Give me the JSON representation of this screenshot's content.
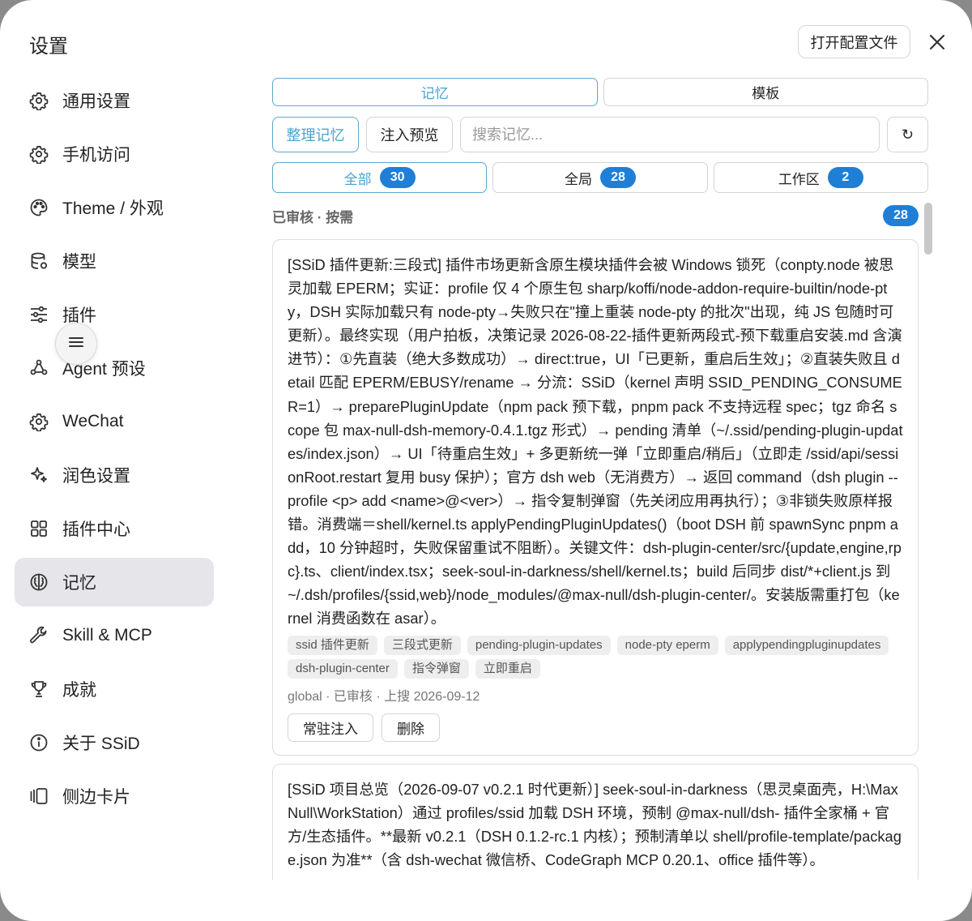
{
  "window": {
    "title": "设置",
    "open_config_label": "打开配置文件"
  },
  "sidebar": {
    "items": [
      {
        "label": "通用设置",
        "icon": "gear-icon"
      },
      {
        "label": "手机访问",
        "icon": "gear-icon"
      },
      {
        "label": "Theme / 外观",
        "icon": "palette-icon"
      },
      {
        "label": "模型",
        "icon": "database-icon"
      },
      {
        "label": "插件",
        "icon": "sliders-icon"
      },
      {
        "label": "Agent 预设",
        "icon": "agent-icon"
      },
      {
        "label": "WeChat",
        "icon": "gear-icon"
      },
      {
        "label": "润色设置",
        "icon": "sparkle-icon"
      },
      {
        "label": "插件中心",
        "icon": "grid-icon"
      },
      {
        "label": "记忆",
        "icon": "brain-icon"
      },
      {
        "label": "Skill & MCP",
        "icon": "wrench-icon"
      },
      {
        "label": "成就",
        "icon": "trophy-icon"
      },
      {
        "label": "关于 SSiD",
        "icon": "info-icon"
      },
      {
        "label": "侧边卡片",
        "icon": "cards-icon"
      }
    ],
    "active_index": 9
  },
  "main": {
    "tabs": [
      {
        "label": "记忆",
        "active": true
      },
      {
        "label": "模板",
        "active": false
      }
    ],
    "toolbar": {
      "organize_label": "整理记忆",
      "preview_label": "注入预览",
      "search_placeholder": "搜索记忆...",
      "refresh_symbol": "↻"
    },
    "filters": [
      {
        "label": "全部",
        "count": "30",
        "active": true
      },
      {
        "label": "全局",
        "count": "28",
        "active": false
      },
      {
        "label": "工作区",
        "count": "2",
        "active": false
      }
    ],
    "section": {
      "title": "已审核 · 按需",
      "count": "28"
    },
    "cards": [
      {
        "text": "[SSiD 插件更新:三段式] 插件市场更新含原生模块插件会被 Windows 锁死（conpty.node 被思灵加载 EPERM；实证：profile 仅 4 个原生包 sharp/koffi/node-addon-require-builtin/node-pty，DSH 实际加载只有 node-pty→失败只在\"撞上重装 node-pty 的批次\"出现，纯 JS 包随时可更新）。最终实现（用户拍板，决策记录 2026-08-22-插件更新两段式-预下载重启安装.md 含演进节）：①先直装（绝大多数成功）→ direct:true，UI「已更新，重启后生效」；②直装失败且 detail 匹配 EPERM/EBUSY/rename → 分流：SSiD（kernel 声明 SSID_PENDING_CONSUMER=1）→ preparePluginUpdate（npm pack 预下载，pnpm pack 不支持远程 spec；tgz 命名 scope 包 max-null-dsh-memory-0.4.1.tgz 形式）→ pending 清单（~/.ssid/pending-plugin-updates/index.json）→ UI「待重启生效」+ 多更新统一弹「立即重启/稍后」（立即走 /ssid/api/sessionRoot.restart 复用 busy 保护）；官方 dsh web（无消费方）→ 返回 command（dsh plugin --profile <p> add <name>@<ver>）→ 指令复制弹窗（先关闭应用再执行）；③非锁失败原样报错。消费端＝shell/kernel.ts applyPendingPluginUpdates()（boot DSH 前 spawnSync pnpm add，10 分钟超时，失败保留重试不阻断）。关键文件：dsh-plugin-center/src/{update,engine,rpc}.ts、client/index.tsx；seek-soul-in-darkness/shell/kernel.ts；build 后同步 dist/*+client.js 到 ~/.dsh/profiles/{ssid,web}/node_modules/@max-null/dsh-plugin-center/。安装版需重打包（kernel 消费函数在 asar）。",
        "tags": [
          "ssid 插件更新",
          "三段式更新",
          "pending-plugin-updates",
          "node-pty eperm",
          "applypendingpluginupdates",
          "dsh-plugin-center",
          "指令弹窗",
          "立即重启"
        ],
        "meta": "global · 已审核 · 上搜 2026-09-12",
        "actions": [
          "常驻注入",
          "删除"
        ]
      },
      {
        "text": "[SSiD 项目总览（2026-09-07 v0.2.1 时代更新）] seek-soul-in-darkness（思灵桌面壳，H:\\MaxNull\\WorkStation）通过 profiles/ssid 加载 DSH 环境，预制 @max-null/dsh- 插件全家桶 + 官方/生态插件。**最新 v0.2.1（DSH 0.1.2-rc.1 内核）；预制清单以 shell/profile-template/package.json 为准**（含 dsh-wechat 微信桥、CodeGraph MCP 0.20.1、office 插件等）。",
        "tags": [],
        "meta": "",
        "actions": []
      }
    ]
  }
}
